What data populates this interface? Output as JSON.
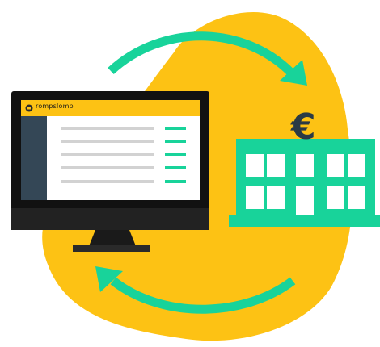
{
  "brand": {
    "logo_text": "rompslomp"
  },
  "bank": {
    "currency_symbol": "€"
  },
  "colors": {
    "blob": "#FDC214",
    "arrow": "#18D39A",
    "building": "#18D39A",
    "monitor": "#111111",
    "screen_header": "#FDC214",
    "screen_sidebar": "#344756",
    "euro": "#2B3A45"
  }
}
